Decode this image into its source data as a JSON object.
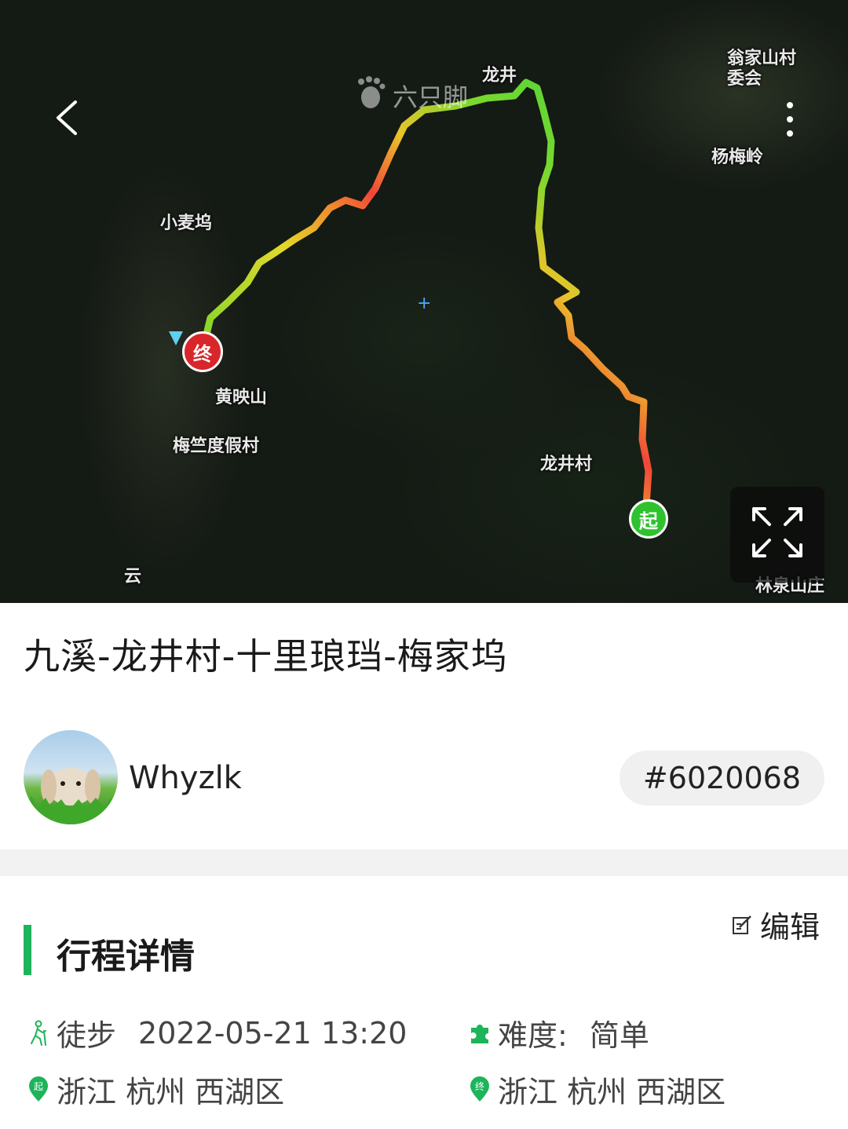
{
  "map": {
    "watermark": "六只脚",
    "labels": {
      "longjing": "龙井",
      "wengjiashan": "翁家山村委会",
      "yangmeiling": "杨梅岭",
      "xiaomaiwu": "小麦坞",
      "huangyingshan": "黄映山",
      "meizhu": "梅竺度假村",
      "longjingcun": "龙井村",
      "linquan": "林泉山庄",
      "yun": "云"
    },
    "end_marker": "终",
    "start_marker": "起",
    "icons": {
      "back": "chevron-left-icon",
      "more": "more-vertical-icon",
      "fullscreen": "expand-icon"
    },
    "route_colors": [
      "#3cd43c",
      "#7ad82e",
      "#e3d82a",
      "#f08a2c",
      "#f2453a"
    ]
  },
  "route": {
    "title": "九溪-龙井村-十里琅珰-梅家坞",
    "user": "Whyzlk",
    "id": "#6020068"
  },
  "details": {
    "section_title": "行程详情",
    "edit_label": "编辑",
    "activity": "徒步",
    "datetime": "2022-05-21 13:20",
    "difficulty_label": "难度:",
    "difficulty_value": "简单",
    "start_location": "浙江 杭州 西湖区",
    "end_location": "浙江 杭州 西湖区"
  },
  "colors": {
    "accent": "#1db45a",
    "end_marker": "#d9262a",
    "start_marker": "#2fc22f"
  }
}
